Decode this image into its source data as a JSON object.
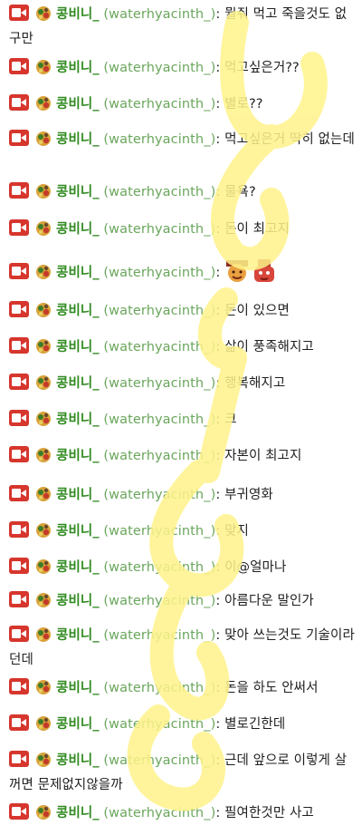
{
  "user": {
    "nickname": "콩비니_",
    "user_id": "(waterhyacinth_)",
    "colon": ":"
  },
  "messages": [
    {
      "text": "뭘줘 먹고 죽을것도 없구만"
    },
    {
      "text": "먹고싶은거??"
    },
    {
      "text": "별로??"
    },
    {
      "text": "먹고싶은거 딱히 없는데"
    },
    {
      "text": "물욕?"
    },
    {
      "text": "돈이 최고지"
    },
    {
      "text": "",
      "emotes": [
        "emote-1",
        "emote-2"
      ]
    },
    {
      "text": "돈이 있으면"
    },
    {
      "text": "삶이 풍족해지고"
    },
    {
      "text": "행복해지고"
    },
    {
      "text": "크"
    },
    {
      "text": "자본이 최고지"
    },
    {
      "text": "부귀영화"
    },
    {
      "text": "맞지"
    },
    {
      "text": "이@얼마나"
    },
    {
      "text": "아름다운 말인가"
    },
    {
      "text": "맞아 쓰는것도 기술이라던데"
    },
    {
      "text": "돈을 하도 안써서"
    },
    {
      "text": "별로긴한데"
    },
    {
      "text": "근데 앞으로 이렇게 살꺼면 문제없지않을까"
    },
    {
      "text": "필여한것만 사고"
    }
  ],
  "colors": {
    "camera_badge": "#d6362d",
    "nickname": "#2f8a1f",
    "user_id": "#6aa65c",
    "watermark": "#fff176"
  }
}
